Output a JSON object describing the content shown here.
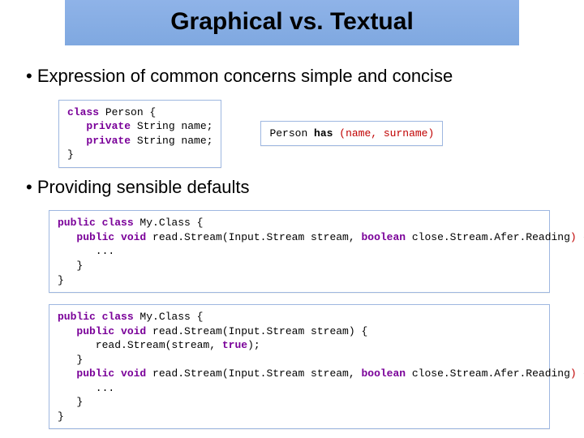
{
  "title": "Graphical vs. Textual",
  "bullet1": "Expression of common concerns simple and concise",
  "bullet2": "Providing sensible defaults",
  "code1": {
    "l1a": "class",
    "l1b": " Person {",
    "l2a": "   private",
    "l2b": " String name;",
    "l3a": "   private",
    "l3b": " String name;",
    "l4": "}"
  },
  "code2": {
    "a": "Person ",
    "b": "has ",
    "c": "(name, surname)"
  },
  "code3": {
    "l1a": "public class",
    "l1b": " My.Class {",
    "l2a": "   public void",
    "l2b": " read.Stream(Input.Stream stream, ",
    "l2c": "boolean",
    "l2d": " close.Stream.Afer.Reading",
    "l2e": ")",
    "l2f": " {",
    "l3": "      ...",
    "l4": "   }",
    "l5": "}"
  },
  "code4": {
    "l1a": "public class",
    "l1b": " My.Class {",
    "l2a": "   public void",
    "l2b": " read.Stream(Input.Stream stream) {",
    "l3": "      read.Stream(stream, ",
    "l3b": "true",
    "l3c": ");",
    "l4": "   }",
    "l5a": "   public void",
    "l5b": " read.Stream(Input.Stream stream, ",
    "l5c": "boolean",
    "l5d": " close.Stream.Afer.Reading",
    "l5e": ")",
    "l5f": " {",
    "l6": "      ...",
    "l7": "   }",
    "l8": "}"
  }
}
